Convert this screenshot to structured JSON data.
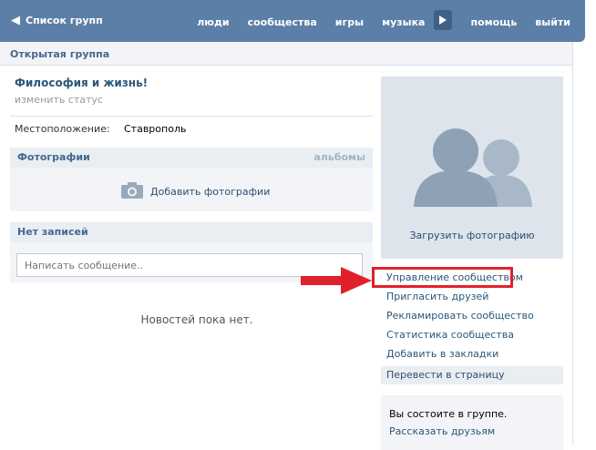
{
  "topbar": {
    "back_label": "Список групп",
    "nav": [
      "люди",
      "сообщества",
      "игры",
      "музыка",
      "помощь",
      "выйти"
    ]
  },
  "subheader": {
    "title": "Открытая группа"
  },
  "group": {
    "name": "Философия и жизнь!",
    "status_link": "изменить статус",
    "location_label": "Местоположение:",
    "location_value": "Ставрополь"
  },
  "photos": {
    "title": "Фотографии",
    "albums_link": "альбомы",
    "add_label": "Добавить фотографии",
    "icon": "camera-icon"
  },
  "posts": {
    "title": "Нет записей",
    "input_placeholder": "Написать сообщение..",
    "empty_text": "Новостей пока нет."
  },
  "sidebar": {
    "upload_label": "Загрузить фотографию",
    "menu": [
      "Управление сообществом",
      "Пригласить друзей",
      "Рекламировать сообщество",
      "Статистика сообщества",
      "Добавить в закладки"
    ],
    "translate_label": "Перевести в страницу",
    "member_text": "Вы состоите в группе.",
    "tell_friends": "Рассказать друзьям"
  },
  "colors": {
    "topbar": "#5b7fa6",
    "link": "#2b587a",
    "highlight": "#e1212a",
    "panel": "#e9eef3"
  }
}
